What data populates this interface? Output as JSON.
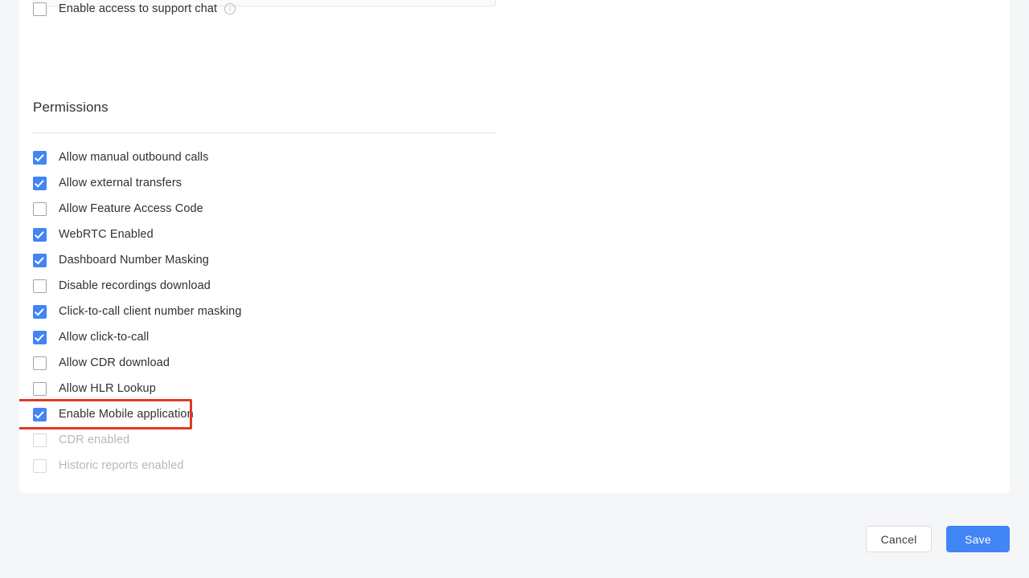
{
  "theme": {
    "page_background": "#f5f6f8",
    "card_background": "#ffffff",
    "accent": "#4285f4",
    "highlight_outline": "#e03a22",
    "text": "#2f3033",
    "text_disabled": "#b6b8bf",
    "divider": "#e3e4e7"
  },
  "form": {
    "support_chat": {
      "label": "Enable access to support chat",
      "checked": false,
      "info_icon": "info-icon",
      "info_glyph": "i"
    }
  },
  "permissions": {
    "title": "Permissions",
    "items": [
      {
        "label": "Allow manual outbound calls",
        "checked": true,
        "disabled": false
      },
      {
        "label": "Allow external transfers",
        "checked": true,
        "disabled": false
      },
      {
        "label": "Allow Feature Access Code",
        "checked": false,
        "disabled": false
      },
      {
        "label": "WebRTC Enabled",
        "checked": true,
        "disabled": false
      },
      {
        "label": "Dashboard Number Masking",
        "checked": true,
        "disabled": false
      },
      {
        "label": "Disable recordings download",
        "checked": false,
        "disabled": false
      },
      {
        "label": "Click-to-call client number masking",
        "checked": true,
        "disabled": false
      },
      {
        "label": "Allow click-to-call",
        "checked": true,
        "disabled": false
      },
      {
        "label": "Allow CDR download",
        "checked": false,
        "disabled": false
      },
      {
        "label": "Allow HLR Lookup",
        "checked": false,
        "disabled": false
      },
      {
        "label": "Enable Mobile application",
        "checked": true,
        "disabled": false,
        "highlighted": true
      },
      {
        "label": "CDR enabled",
        "checked": false,
        "disabled": true
      },
      {
        "label": "Historic reports enabled",
        "checked": false,
        "disabled": true
      }
    ]
  },
  "footer": {
    "cancel_label": "Cancel",
    "save_label": "Save"
  }
}
